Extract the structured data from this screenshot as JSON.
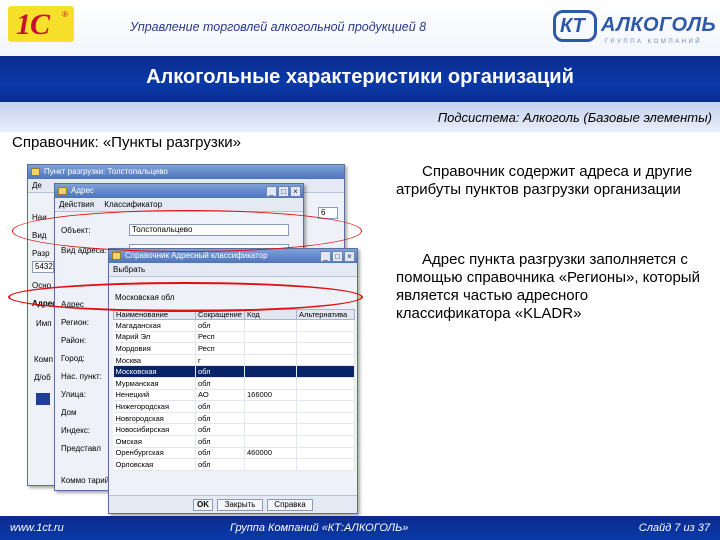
{
  "header": {
    "title": "Управление торговлей алкогольной продукцией 8",
    "logo_left_text": "1С",
    "logo_right_box": "КТ",
    "logo_right_word": "АЛКОГОЛЬ",
    "logo_right_sub": "ГРУППА КОМПАНИЙ"
  },
  "slide": {
    "title": "Алкогольные характеристики организаций",
    "subsystem": "Подсистема: Алкоголь (Базовые элементы)",
    "catalog_heading": "Справочник: «Пункты разгрузки»",
    "paragraph_1": "Справочник содержит адреса и другие атрибуты пунктов разгрузки организации",
    "paragraph_2": "Адрес пункта разгрузки заполняется с помощью справочника «Регионы», который является частью адресного классификатора «KLADR»"
  },
  "footer": {
    "url": "www.1ct.ru",
    "company": "Группа Компаний «КТ:АЛКОГОЛЬ»",
    "slide_number": "Слайд 7 из 37"
  },
  "win_org": {
    "title": "Пункт разгрузки: Толстопальцево",
    "toolbar_actions": "Де",
    "labels": [
      "Наи",
      "Вид",
      "Разр",
      "5432",
      "Осно",
      "Адрес",
      "Имп",
      "Комп",
      "Д/об"
    ],
    "field_value": "6"
  },
  "win_addr": {
    "title": "Адрес",
    "toolbar": [
      "Действия",
      "Классификатор"
    ],
    "fields": [
      {
        "label": "Объект:",
        "value": "Толстопальцево"
      },
      {
        "label": "Вид адреса:",
        "value": ""
      }
    ],
    "address_labels": [
      "Адрес",
      "Регион:",
      "Район:",
      "Город:",
      "Нас. пункт:",
      "Улица:",
      "Дом",
      "Индекс:",
      "Представл"
    ],
    "comment_label": "Коммо тарий"
  },
  "win_class": {
    "title": "Справочник Адресный классификатор",
    "toolbar": [
      "Выбрать"
    ],
    "current_value": "Московская обл",
    "columns": [
      "Наименование",
      "Сокращение",
      "Код",
      "Альтернатива"
    ],
    "rows": [
      [
        "Магаданская",
        "обл",
        "",
        ""
      ],
      [
        "Марий Эл",
        "Респ",
        "",
        ""
      ],
      [
        "Мордовия",
        "Респ",
        "",
        ""
      ],
      [
        "Москва",
        "г",
        "",
        ""
      ],
      [
        "Московская",
        "обл",
        "",
        ""
      ],
      [
        "Мурманская",
        "обл",
        "",
        ""
      ],
      [
        "Ненецкий",
        "АО",
        "166000",
        ""
      ],
      [
        "Нижегородская",
        "обл",
        "",
        ""
      ],
      [
        "Новгородская",
        "обл",
        "",
        ""
      ],
      [
        "Новосибирская",
        "обл",
        "",
        ""
      ],
      [
        "Омская",
        "обл",
        "",
        ""
      ],
      [
        "Оренбургская",
        "обл",
        "460000",
        ""
      ],
      [
        "Орловская",
        "обл",
        "",
        ""
      ]
    ],
    "selected_row": 4,
    "buttons": [
      "OK",
      "Закрыть",
      "Справка"
    ]
  },
  "colors": {
    "brand_blue": "#0b2a8f",
    "highlight_red": "#e01010",
    "logo_yellow": "#f7e02a",
    "logo_red": "#c8102e"
  }
}
